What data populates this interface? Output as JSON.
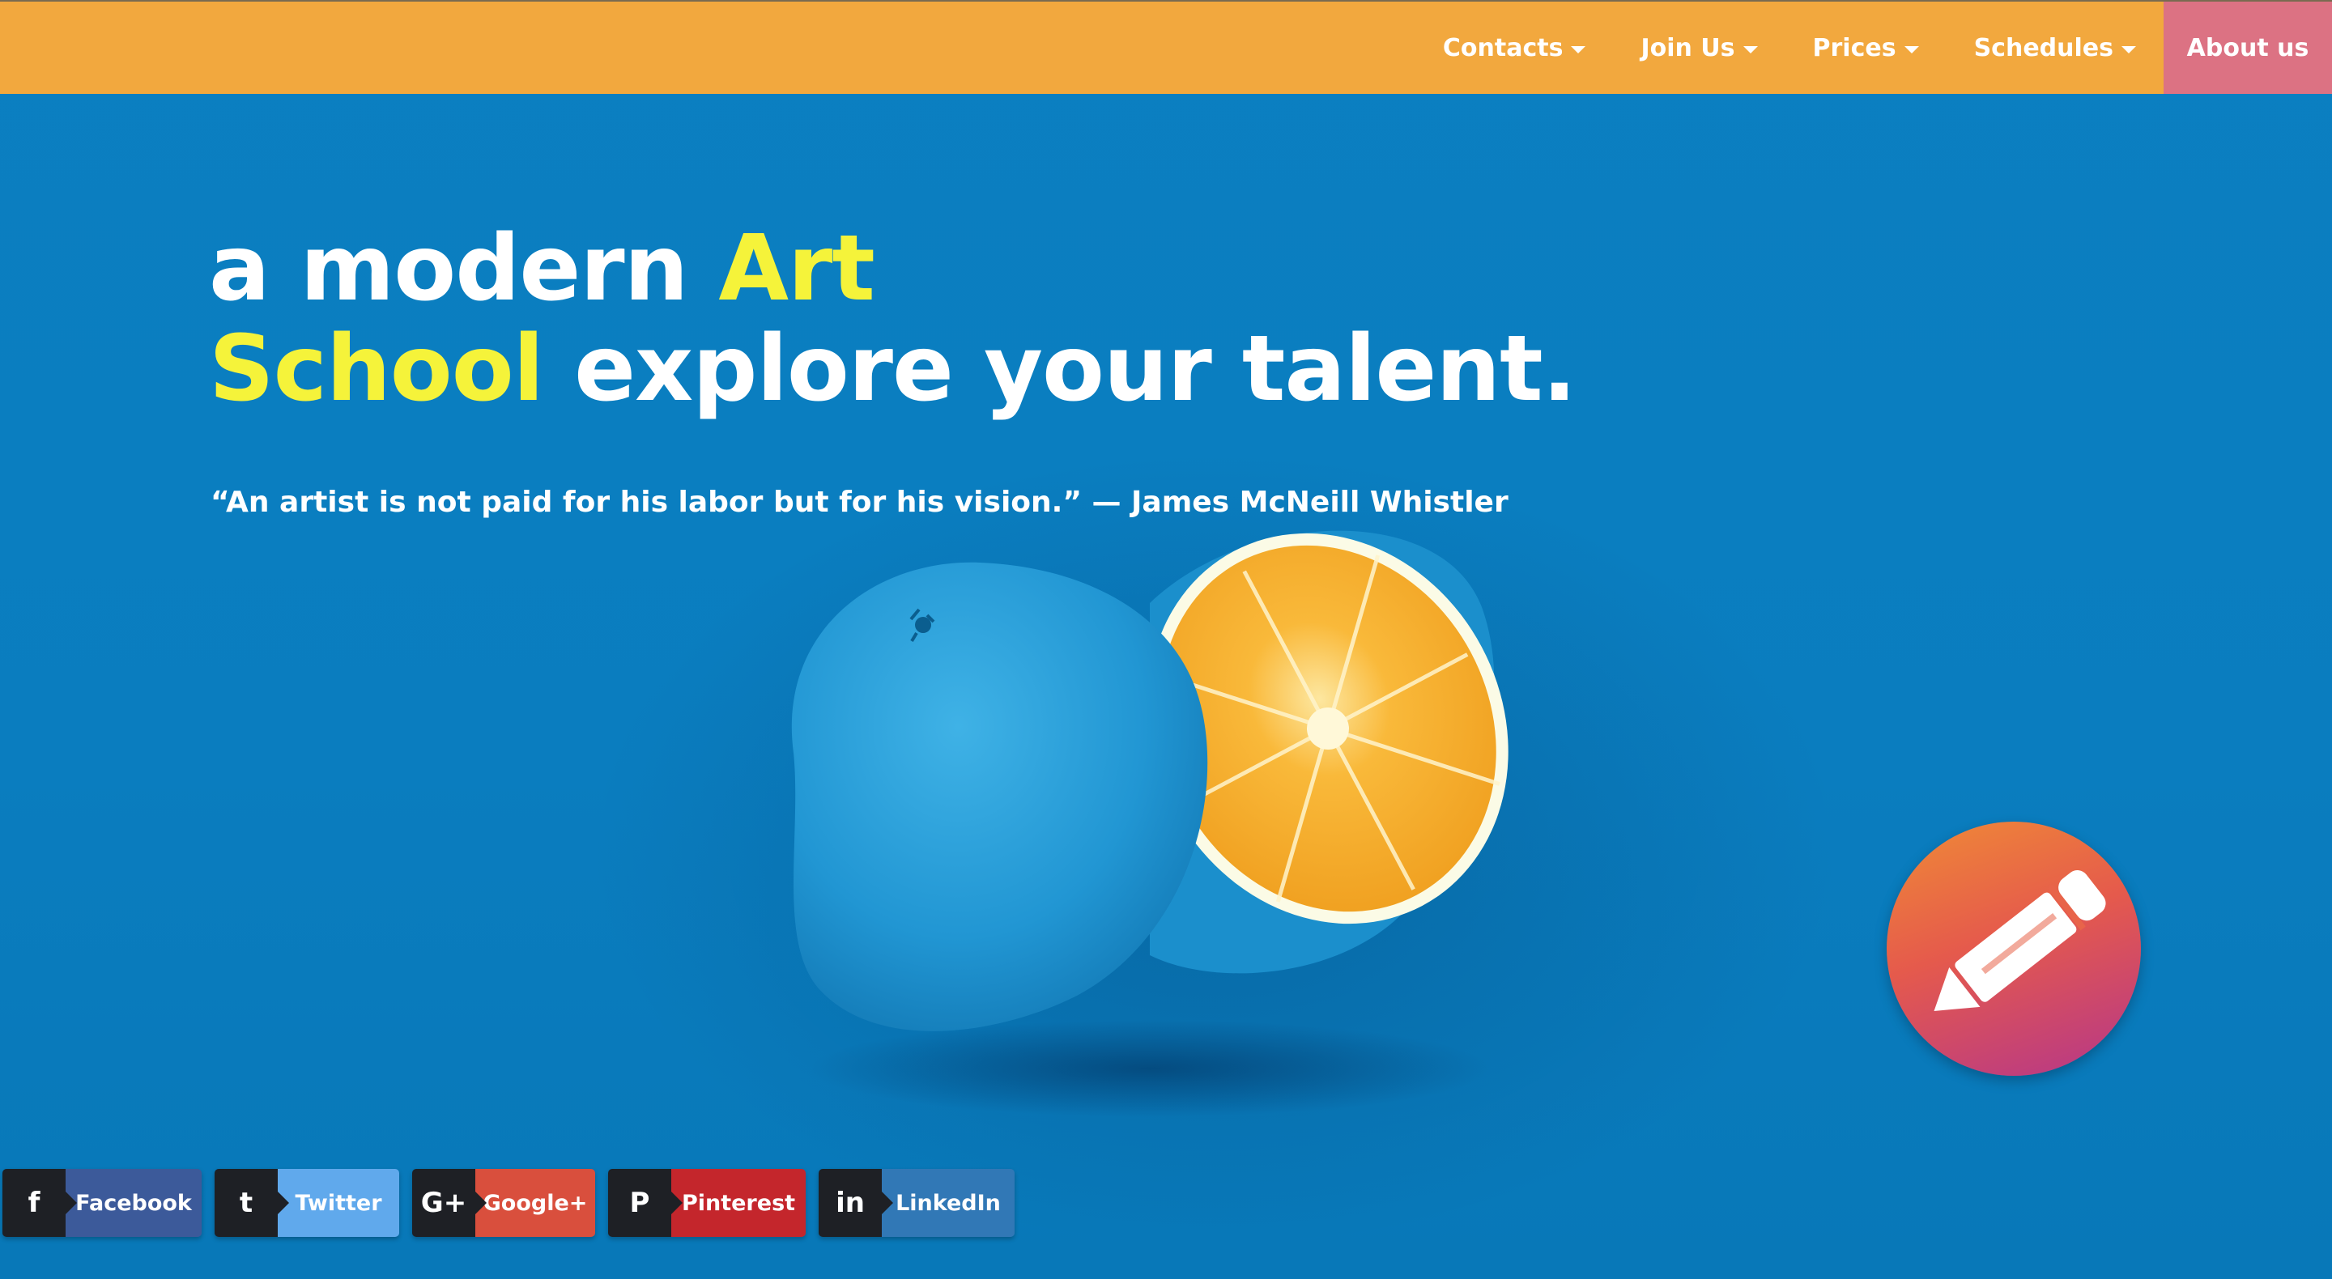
{
  "navbar": {
    "items": [
      {
        "label": "Contacts",
        "dropdown": true
      },
      {
        "label": "Join Us",
        "dropdown": true
      },
      {
        "label": "Prices",
        "dropdown": true
      },
      {
        "label": "Schedules",
        "dropdown": true
      },
      {
        "label": "About us",
        "dropdown": false
      }
    ],
    "colors": {
      "bar": "#f2a83e",
      "active": "#dc7283"
    }
  },
  "hero": {
    "headline_1": "a modern ",
    "headline_2": "Art",
    "headline_3": "School",
    "headline_4": " explore your talent.",
    "quote": "“An artist is not paid for his labor but for his vision.” — James McNeill Whistler",
    "accent_color": "#f5f33a"
  },
  "fab": {
    "icon": "pencil-icon"
  },
  "social": [
    {
      "label": "Facebook",
      "icon": "facebook-icon",
      "glyph": "f",
      "color": "#3c5a9a"
    },
    {
      "label": "Twitter",
      "icon": "twitter-icon",
      "glyph": "t",
      "color": "#60a9ec"
    },
    {
      "label": "Google+",
      "icon": "google-plus-icon",
      "glyph": "G+",
      "color": "#d94f3d"
    },
    {
      "label": "Pinterest",
      "icon": "pinterest-icon",
      "glyph": "P",
      "color": "#c4262c"
    },
    {
      "label": "LinkedIn",
      "icon": "linkedin-icon",
      "glyph": "in",
      "color": "#3178b6"
    }
  ]
}
